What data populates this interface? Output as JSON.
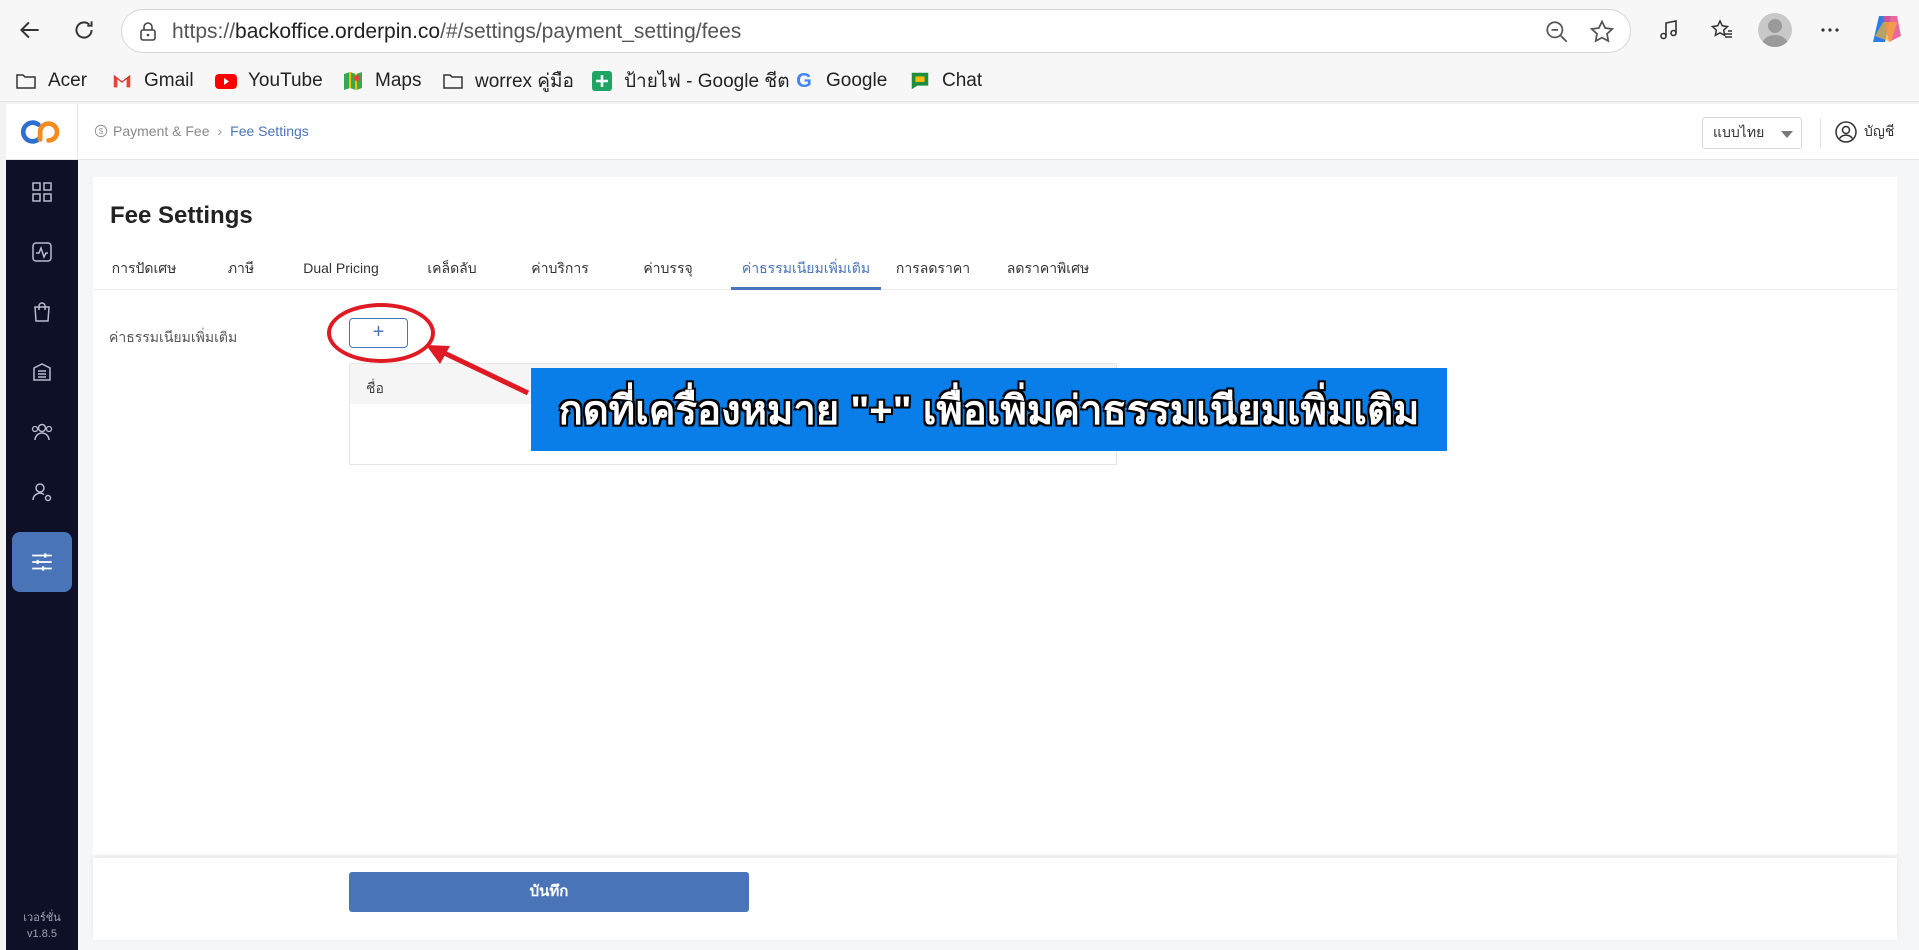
{
  "browser": {
    "url_prefix": "https://",
    "url_host": "backoffice.orderpin.co",
    "url_path": "/#/settings/payment_setting/fees"
  },
  "bookmarks": [
    {
      "label": "Acer",
      "icon": "folder-icon"
    },
    {
      "label": "Gmail",
      "icon": "gmail-icon"
    },
    {
      "label": "YouTube",
      "icon": "youtube-icon"
    },
    {
      "label": "Maps",
      "icon": "maps-icon"
    },
    {
      "label": "worrex คู่มือ",
      "icon": "folder-icon"
    },
    {
      "label": "ป้ายไฟ - Google ชีต",
      "icon": "sheets-icon"
    },
    {
      "label": "Google",
      "icon": "google-icon"
    },
    {
      "label": "Chat",
      "icon": "chat-icon"
    }
  ],
  "header": {
    "breadcrumb_parent": "Payment & Fee",
    "breadcrumb_current": "Fee Settings",
    "language": "แบบไทย",
    "account_label": "บัญชี"
  },
  "sidebar": {
    "items": [
      "dashboard-icon",
      "activity-icon",
      "shopping-bag-icon",
      "building-icon",
      "users-icon",
      "user-settings-icon",
      "sliders-icon"
    ],
    "version_label": "เวอร์ชั่น",
    "version": "v1.8.5"
  },
  "main": {
    "title": "Fee Settings",
    "tabs": [
      {
        "label": "การปัดเศษ",
        "active": false
      },
      {
        "label": "ภาษี",
        "active": false
      },
      {
        "label": "Dual Pricing",
        "active": false
      },
      {
        "label": "เคล็ดลับ",
        "active": false
      },
      {
        "label": "ค่าบริการ",
        "active": false
      },
      {
        "label": "ค่าบรรจุ",
        "active": false
      },
      {
        "label": "ค่าธรรมเนียมเพิ่มเติม",
        "active": true
      },
      {
        "label": "การลดราคา",
        "active": false
      },
      {
        "label": "ลดราคาพิเศษ",
        "active": false
      }
    ],
    "field_label": "ค่าธรรมเนียมเพิ่มเติม",
    "add_label": "+",
    "table_header": "ชื่อ",
    "save_label": "บันทึก"
  },
  "annotation": {
    "text": "กดที่เครื่องหมาย \"+\" เพื่อเพิ่มค่าธรรมเนียมเพิ่มเติม",
    "banner_color": "#0a7ee8",
    "highlight_color": "#e01a22"
  },
  "colors": {
    "accent": "#4a74b8",
    "sidebar": "#0e1027"
  }
}
